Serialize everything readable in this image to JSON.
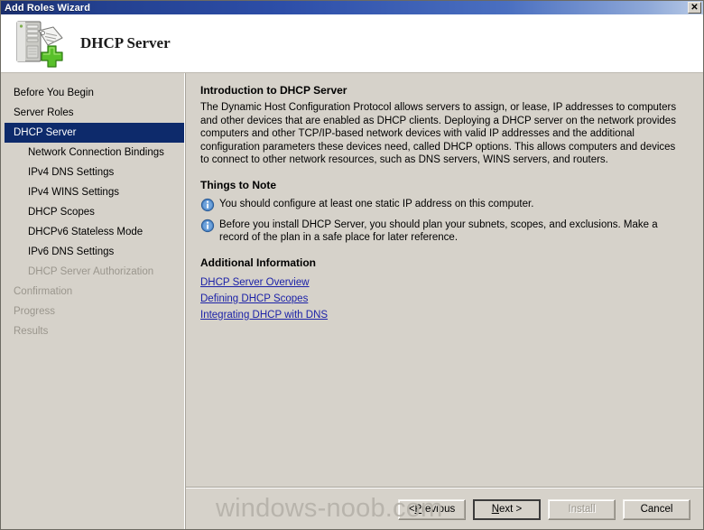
{
  "window": {
    "title": "Add Roles Wizard",
    "close_label": "✕"
  },
  "header": {
    "title": "DHCP Server",
    "icon": "dhcp-server-add-icon"
  },
  "sidebar": {
    "items": [
      {
        "label": "Before You Begin",
        "state": "normal",
        "indent": false
      },
      {
        "label": "Server Roles",
        "state": "normal",
        "indent": false
      },
      {
        "label": "DHCP Server",
        "state": "selected",
        "indent": false
      },
      {
        "label": "Network Connection Bindings",
        "state": "normal",
        "indent": true
      },
      {
        "label": "IPv4 DNS Settings",
        "state": "normal",
        "indent": true
      },
      {
        "label": "IPv4 WINS Settings",
        "state": "normal",
        "indent": true
      },
      {
        "label": "DHCP Scopes",
        "state": "normal",
        "indent": true
      },
      {
        "label": "DHCPv6 Stateless Mode",
        "state": "normal",
        "indent": true
      },
      {
        "label": "IPv6 DNS Settings",
        "state": "normal",
        "indent": true
      },
      {
        "label": "DHCP Server Authorization",
        "state": "disabled",
        "indent": true
      },
      {
        "label": "Confirmation",
        "state": "disabled",
        "indent": false
      },
      {
        "label": "Progress",
        "state": "disabled",
        "indent": false
      },
      {
        "label": "Results",
        "state": "disabled",
        "indent": false
      }
    ]
  },
  "content": {
    "intro_heading": "Introduction to DHCP Server",
    "intro_paragraph": "The Dynamic Host Configuration Protocol allows servers to assign, or lease, IP addresses to computers and other devices that are enabled as DHCP clients. Deploying a DHCP server on the network provides computers and other TCP/IP-based network devices with valid IP addresses and the additional configuration parameters these devices need, called DHCP options. This allows computers and devices to connect to other network resources, such as DNS servers, WINS servers, and routers.",
    "things_heading": "Things to Note",
    "notes": [
      {
        "icon": "info-icon",
        "text": "You should configure at least one static IP address on this computer."
      },
      {
        "icon": "info-icon",
        "text": "Before you install DHCP Server, you should plan your subnets, scopes, and exclusions. Make a record of the plan in a safe place for later reference."
      }
    ],
    "additional_heading": "Additional Information",
    "links": [
      "DHCP Server Overview",
      "Defining DHCP Scopes",
      "Integrating DHCP with DNS"
    ]
  },
  "buttons": {
    "previous": {
      "prefix": "< ",
      "accel": "P",
      "suffix": "revious",
      "state": "enabled"
    },
    "next": {
      "prefix": "",
      "accel": "N",
      "suffix": "ext >",
      "state": "default"
    },
    "install": {
      "label": "Install",
      "state": "disabled"
    },
    "cancel": {
      "label": "Cancel",
      "state": "enabled"
    }
  },
  "watermark": {
    "text": "windows-noob.com"
  },
  "colors": {
    "titlebar_start": "#1b2f6e",
    "titlebar_end": "#b9cbe6",
    "selection": "#0d2a6b",
    "link": "#1c22a8",
    "face": "#d6d2ca",
    "disabled_text": "#9a968d"
  }
}
